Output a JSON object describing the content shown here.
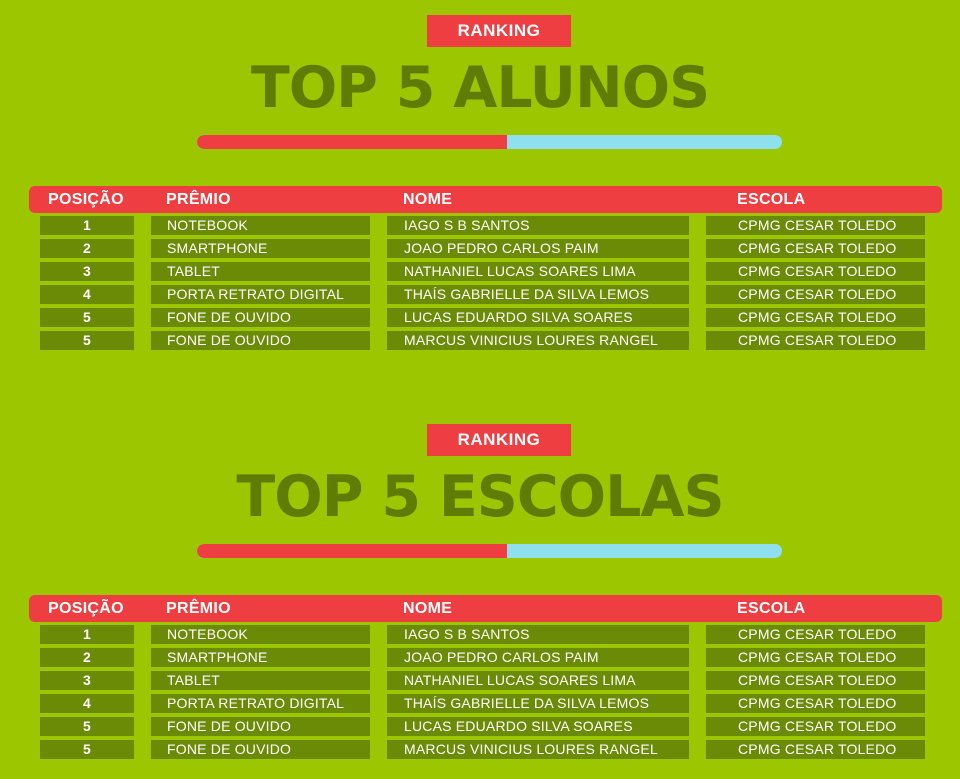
{
  "sections": [
    {
      "badge": "RANKING",
      "title": "TOP 5 ALUNOS",
      "progress": 0.53,
      "headers": {
        "position": "POSIÇÃO",
        "prize": "PRÊMIO",
        "name": "NOME",
        "school": "ESCOLA"
      },
      "rows": [
        {
          "position": "1",
          "prize": "NOTEBOOK",
          "name": "IAGO S B SANTOS",
          "school": "CPMG CESAR TOLEDO"
        },
        {
          "position": "2",
          "prize": "SMARTPHONE",
          "name": "JOAO PEDRO CARLOS PAIM",
          "school": "CPMG CESAR TOLEDO"
        },
        {
          "position": "3",
          "prize": "TABLET",
          "name": "NATHANIEL LUCAS SOARES LIMA",
          "school": "CPMG CESAR TOLEDO"
        },
        {
          "position": "4",
          "prize": "PORTA RETRATO DIGITAL",
          "name": "THAÍS GABRIELLE DA SILVA LEMOS",
          "school": "CPMG CESAR TOLEDO"
        },
        {
          "position": "5",
          "prize": "FONE DE OUVIDO",
          "name": "LUCAS EDUARDO SILVA SOARES",
          "school": "CPMG CESAR TOLEDO"
        },
        {
          "position": "5",
          "prize": "FONE DE OUVIDO",
          "name": "MARCUS VINICIUS LOURES RANGEL",
          "school": "CPMG CESAR TOLEDO"
        }
      ]
    },
    {
      "badge": "RANKING",
      "title": "TOP 5 ESCOLAS",
      "progress": 0.53,
      "headers": {
        "position": "POSIÇÃO",
        "prize": "PRÊMIO",
        "name": "NOME",
        "school": "ESCOLA"
      },
      "rows": [
        {
          "position": "1",
          "prize": "NOTEBOOK",
          "name": "IAGO S B SANTOS",
          "school": "CPMG CESAR TOLEDO"
        },
        {
          "position": "2",
          "prize": "SMARTPHONE",
          "name": "JOAO PEDRO CARLOS PAIM",
          "school": "CPMG CESAR TOLEDO"
        },
        {
          "position": "3",
          "prize": "TABLET",
          "name": "NATHANIEL LUCAS SOARES LIMA",
          "school": "CPMG CESAR TOLEDO"
        },
        {
          "position": "4",
          "prize": "PORTA RETRATO DIGITAL",
          "name": "THAÍS GABRIELLE DA SILVA LEMOS",
          "school": "CPMG CESAR TOLEDO"
        },
        {
          "position": "5",
          "prize": "FONE DE OUVIDO",
          "name": "LUCAS EDUARDO SILVA SOARES",
          "school": "CPMG CESAR TOLEDO"
        },
        {
          "position": "5",
          "prize": "FONE DE OUVIDO",
          "name": "MARCUS VINICIUS LOURES RANGEL",
          "school": "CPMG CESAR TOLEDO"
        }
      ]
    }
  ],
  "colors": {
    "background": "#9cc600",
    "accent_red": "#ee3e42",
    "bar_track": "#8fe0ef",
    "title_green": "#5f7d05",
    "cell_green": "#6b8a06"
  }
}
